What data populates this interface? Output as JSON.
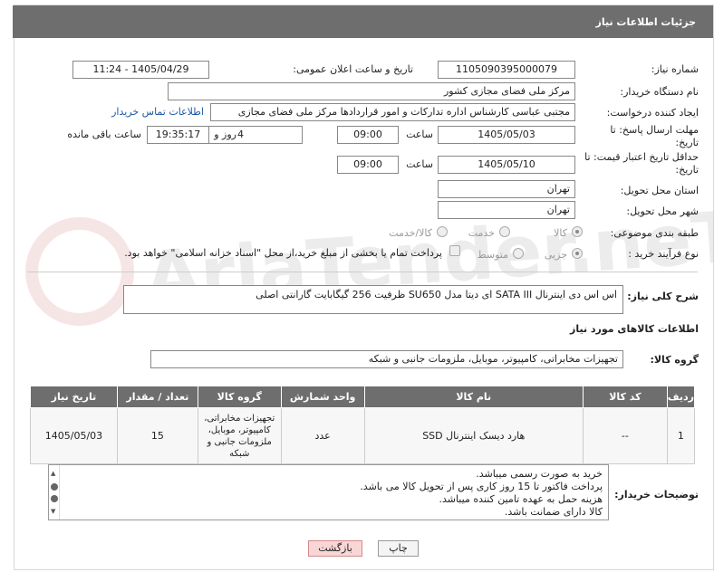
{
  "header": {
    "title": "جزئیات اطلاعات نیاز"
  },
  "fields": {
    "need_number_label": "شماره نیاز:",
    "need_number": "1105090395000079",
    "announce_label": "تاریخ و ساعت اعلان عمومی:",
    "announce_value": "1405/04/29 - 11:24",
    "buyer_org_label": "نام دستگاه خریدار:",
    "buyer_org": "مرکز ملی فضای مجازی کشور",
    "creator_label": "ایجاد کننده درخواست:",
    "creator": "مجتبی عباسی کارشناس اداره تدارکات و امور قراردادها مرکز ملی فضای مجازی",
    "contact_link": "اطلاعات تماس خریدار",
    "deadline_label": "مهلت ارسال پاسخ: تا تاریخ:",
    "deadline_date": "1405/05/03",
    "time_label": "ساعت",
    "deadline_time": "09:00",
    "days_value": "4",
    "days_label": "روز و",
    "remaining_time": "19:35:17",
    "remaining_label": "ساعت باقی مانده",
    "validity_label": "حداقل تاریخ اعتبار قیمت: تا تاریخ:",
    "validity_date": "1405/05/10",
    "validity_time": "09:00",
    "province_label": "استان محل تحویل:",
    "province": "تهران",
    "city_label": "شهر محل تحویل:",
    "city": "تهران",
    "category_label": "طبقه بندی موضوعی:",
    "category_options": [
      "کالا",
      "خدمت",
      "کالا/خدمت"
    ],
    "process_label": "نوع فرآیند خرید :",
    "process_options": [
      "جزیی",
      "متوسط"
    ],
    "payment_note": "پرداخت تمام یا بخشی از مبلغ خرید،از محل \"اسناد خزانه اسلامی\" خواهد بود."
  },
  "summary": {
    "label": "شرح کلی نیاز:",
    "text": "اس اس دی اینترنال SATA III ای دیتا مدل SU650 ظرفیت 256 گیگابایت گارانتی اصلی"
  },
  "goods_info_title": "اطلاعات کالاهای مورد نیاز",
  "goods_group": {
    "label": "گروه کالا:",
    "value": "تجهیزات مخابراتی، کامپیوتر، موبایل، ملزومات جانبی و شبکه"
  },
  "table": {
    "headers": [
      "ردیف",
      "کد کالا",
      "نام کالا",
      "واحد شمارش",
      "گروه کالا",
      "تعداد / مقدار",
      "تاریخ نیاز"
    ],
    "rows": [
      [
        "1",
        "--",
        "هارد دیسک اینترنال SSD",
        "عدد",
        "تجهیزات مخابراتی، کامپیوتر، موبایل، ملزومات جانبی و شبکه",
        "15",
        "1405/05/03"
      ]
    ]
  },
  "buyer_notes": {
    "label": "توضیحات خریدار:",
    "lines": [
      "خرید به صورت رسمی میباشد.",
      "پرداخت فاکتور تا 15 روز کاری پس از تحویل کالا می باشد.",
      "هزینه حمل به عهده تامین کننده میباشد.",
      "کالا دارای ضمانت باشد."
    ]
  },
  "buttons": {
    "print": "چاپ",
    "back": "بازگشت"
  },
  "watermark": "AriaTender.neT"
}
